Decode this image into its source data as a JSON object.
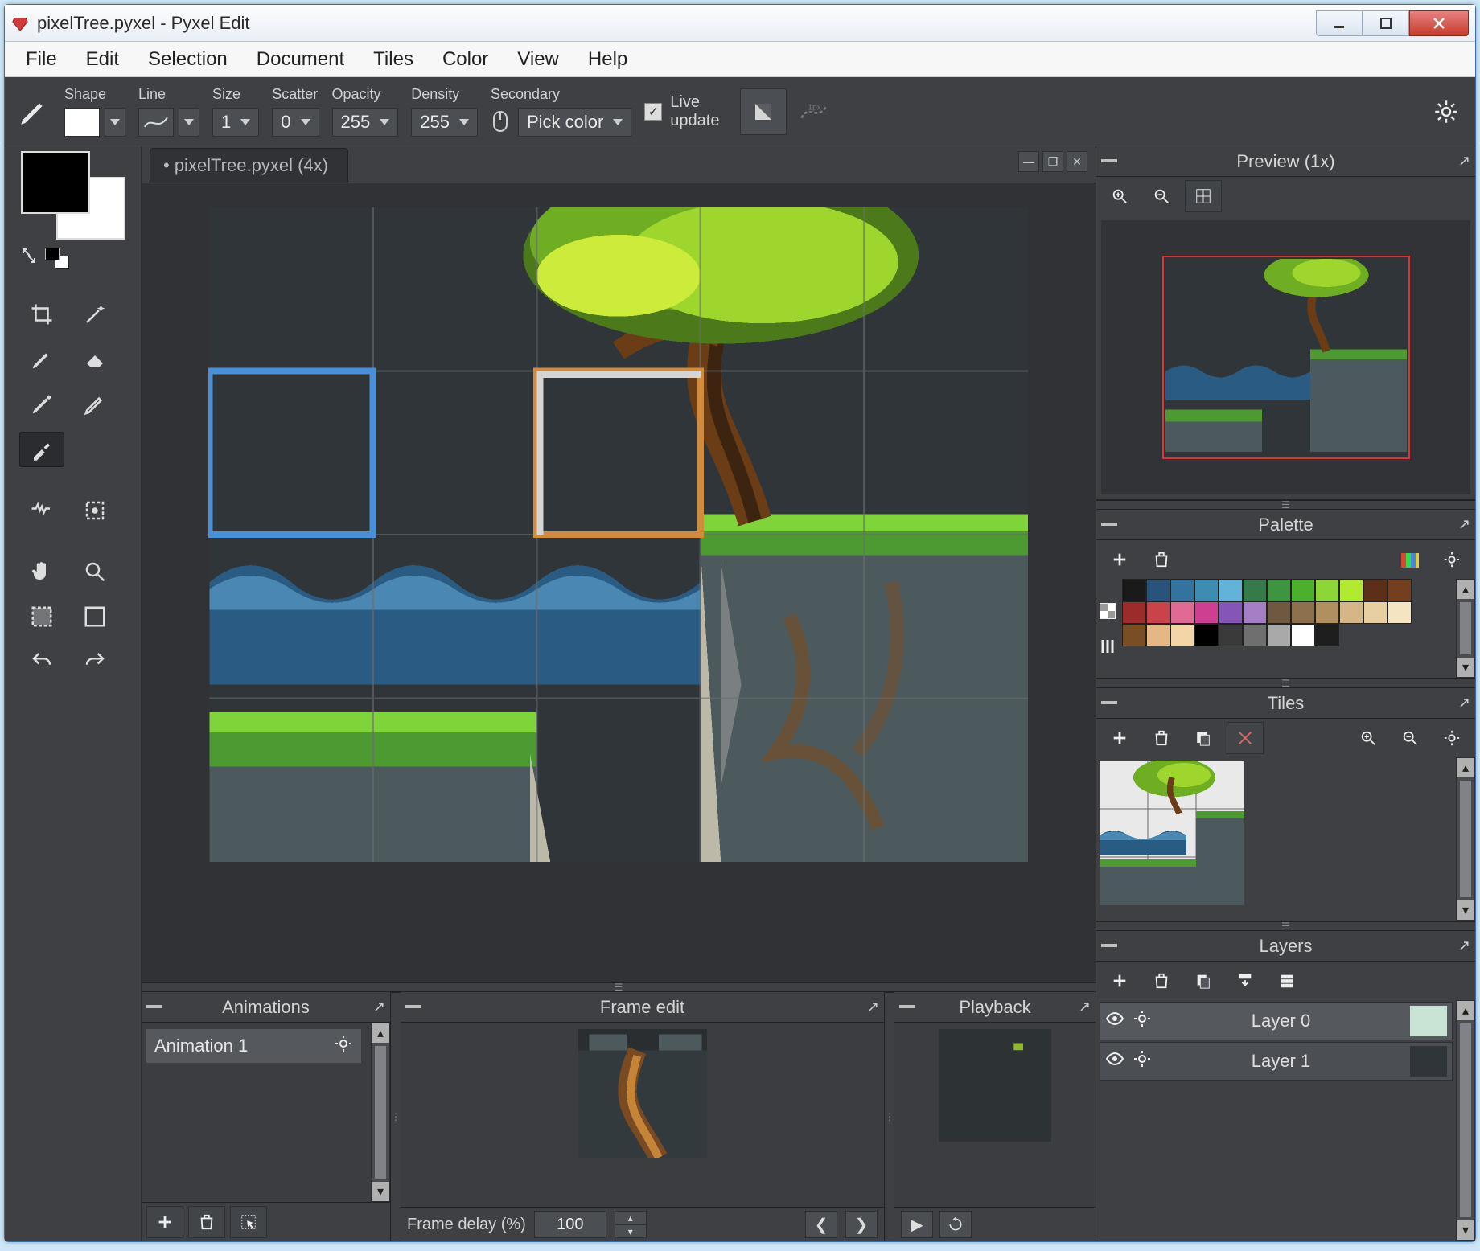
{
  "window": {
    "title": "pixelTree.pyxel - Pyxel Edit"
  },
  "menu": {
    "items": [
      "File",
      "Edit",
      "Selection",
      "Document",
      "Tiles",
      "Color",
      "View",
      "Help"
    ]
  },
  "toolbar": {
    "brush_icon": "pen-icon",
    "shape": {
      "label": "Shape"
    },
    "line": {
      "label": "Line"
    },
    "size": {
      "label": "Size",
      "value": "1"
    },
    "scatter": {
      "label": "Scatter",
      "value": "0"
    },
    "opacity": {
      "label": "Opacity",
      "value": "255"
    },
    "density": {
      "label": "Density",
      "value": "255"
    },
    "secondary": {
      "label": "Secondary",
      "value": "Pick color"
    },
    "live_update": {
      "label": "Live\nupdate",
      "checked": true
    },
    "settings_icon": "gear-icon"
  },
  "document": {
    "tab_label": "• pixelTree.pyxel  (4x)"
  },
  "panels": {
    "preview": {
      "title": "Preview (1x)"
    },
    "palette": {
      "title": "Palette",
      "colors_row1": [
        "#1a1a1a",
        "#28537a",
        "#34739d",
        "#3f8cb3",
        "#63b2d8",
        "#367a4b",
        "#3e9441",
        "#4cb02c",
        "#8dd637",
        "#b2ea2f",
        "#5c3018",
        "#733f1e"
      ],
      "colors_row2": [
        "#9c2c2c",
        "#c94348",
        "#e06a93",
        "#cf3f91",
        "#8556b6",
        "#a57fc6",
        "#6e5940",
        "#8d714d",
        "#b0905f",
        "#d6b686",
        "#e7cfa2",
        "#f5e4c2"
      ],
      "colors_row3": [
        "#7a4e24",
        "#e3b884",
        "#f2d6a8",
        "#000000",
        "#3a3a3a",
        "#6f6f6f",
        "#a9a9a9",
        "#ffffff",
        "#1e1e1e"
      ]
    },
    "tiles": {
      "title": "Tiles"
    },
    "layers": {
      "title": "Layers",
      "items": [
        "Layer 0",
        "Layer 1"
      ]
    },
    "animations": {
      "title": "Animations",
      "items": [
        "Animation 1"
      ]
    },
    "frame_edit": {
      "title": "Frame edit",
      "delay_label": "Frame delay (%)",
      "delay_value": "100"
    },
    "playback": {
      "title": "Playback"
    }
  }
}
